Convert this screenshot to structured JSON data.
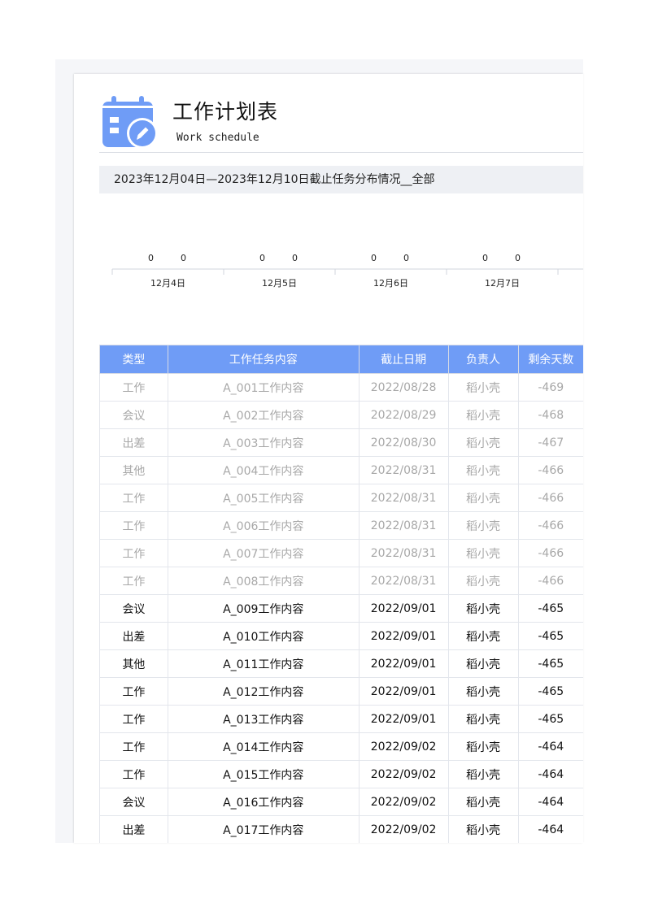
{
  "header": {
    "title": "工作计划表",
    "subtitle": "Work schedule",
    "icon": "calendar-edit-icon",
    "accent_color": "#6f9cf6"
  },
  "banner": {
    "text": "2023年12月04日—2023年12月10日截止任务分布情况__全部"
  },
  "chart_data": {
    "type": "bar",
    "categories": [
      "12月4日",
      "12月5日",
      "12月6日",
      "12月7日"
    ],
    "series": [
      {
        "values": [
          0,
          0,
          0,
          0
        ]
      },
      {
        "values": [
          0,
          0,
          0,
          0
        ]
      }
    ]
  },
  "table": {
    "columns": [
      "类型",
      "工作任务内容",
      "截止日期",
      "负责人",
      "剩余天数"
    ],
    "rows": [
      {
        "type": "工作",
        "task": "A_001工作内容",
        "due": "2022/08/28",
        "owner": "稻小壳",
        "days": "-469",
        "past": true
      },
      {
        "type": "会议",
        "task": "A_002工作内容",
        "due": "2022/08/29",
        "owner": "稻小壳",
        "days": "-468",
        "past": true
      },
      {
        "type": "出差",
        "task": "A_003工作内容",
        "due": "2022/08/30",
        "owner": "稻小壳",
        "days": "-467",
        "past": true
      },
      {
        "type": "其他",
        "task": "A_004工作内容",
        "due": "2022/08/31",
        "owner": "稻小壳",
        "days": "-466",
        "past": true
      },
      {
        "type": "工作",
        "task": "A_005工作内容",
        "due": "2022/08/31",
        "owner": "稻小壳",
        "days": "-466",
        "past": true
      },
      {
        "type": "工作",
        "task": "A_006工作内容",
        "due": "2022/08/31",
        "owner": "稻小壳",
        "days": "-466",
        "past": true
      },
      {
        "type": "工作",
        "task": "A_007工作内容",
        "due": "2022/08/31",
        "owner": "稻小壳",
        "days": "-466",
        "past": true
      },
      {
        "type": "工作",
        "task": "A_008工作内容",
        "due": "2022/08/31",
        "owner": "稻小壳",
        "days": "-466",
        "past": true
      },
      {
        "type": "会议",
        "task": "A_009工作内容",
        "due": "2022/09/01",
        "owner": "稻小壳",
        "days": "-465",
        "past": false
      },
      {
        "type": "出差",
        "task": "A_010工作内容",
        "due": "2022/09/01",
        "owner": "稻小壳",
        "days": "-465",
        "past": false
      },
      {
        "type": "其他",
        "task": "A_011工作内容",
        "due": "2022/09/01",
        "owner": "稻小壳",
        "days": "-465",
        "past": false
      },
      {
        "type": "工作",
        "task": "A_012工作内容",
        "due": "2022/09/01",
        "owner": "稻小壳",
        "days": "-465",
        "past": false
      },
      {
        "type": "工作",
        "task": "A_013工作内容",
        "due": "2022/09/01",
        "owner": "稻小壳",
        "days": "-465",
        "past": false
      },
      {
        "type": "工作",
        "task": "A_014工作内容",
        "due": "2022/09/02",
        "owner": "稻小壳",
        "days": "-464",
        "past": false
      },
      {
        "type": "工作",
        "task": "A_015工作内容",
        "due": "2022/09/02",
        "owner": "稻小壳",
        "days": "-464",
        "past": false
      },
      {
        "type": "会议",
        "task": "A_016工作内容",
        "due": "2022/09/02",
        "owner": "稻小壳",
        "days": "-464",
        "past": false
      },
      {
        "type": "出差",
        "task": "A_017工作内容",
        "due": "2022/09/02",
        "owner": "稻小壳",
        "days": "-464",
        "past": false
      }
    ]
  }
}
